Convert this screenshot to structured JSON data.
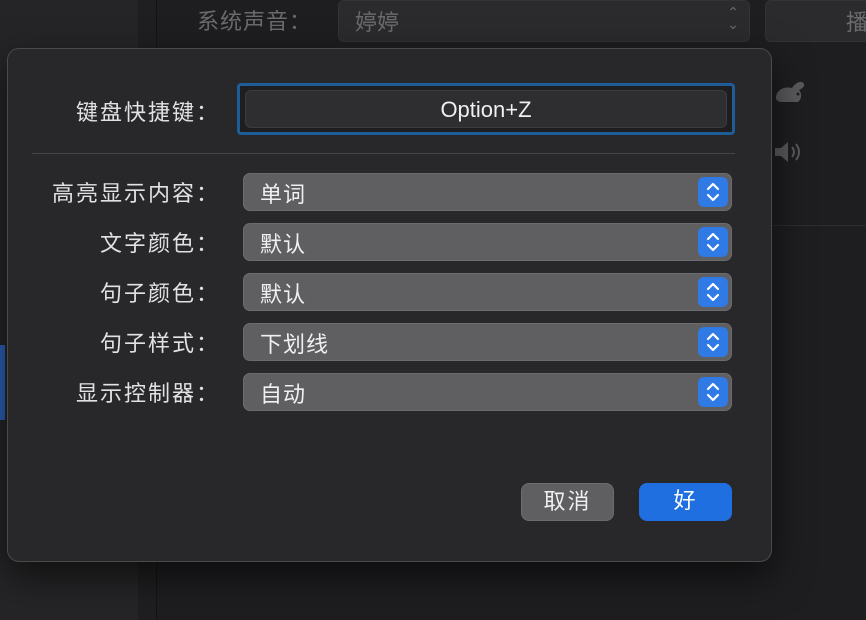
{
  "background": {
    "system_sound_label": "系统声音：",
    "system_sound_value": "婷婷",
    "play_button_label": "播"
  },
  "dialog": {
    "shortcut": {
      "label": "键盘快捷键：",
      "value": "Option+Z"
    },
    "fields": [
      {
        "label": "高亮显示内容：",
        "value": "单词"
      },
      {
        "label": "文字颜色：",
        "value": "默认"
      },
      {
        "label": "句子颜色：",
        "value": "默认"
      },
      {
        "label": "句子样式：",
        "value": "下划线"
      },
      {
        "label": "显示控制器：",
        "value": "自动"
      }
    ],
    "cancel_label": "取消",
    "ok_label": "好"
  },
  "colors": {
    "accent": "#1f6fe0",
    "focus_ring": "#1f5d98",
    "sheet_bg": "#28282a"
  },
  "icons": {
    "stepper": "chevron-up-down-icon",
    "rabbit": "rabbit-icon",
    "speaker": "speaker-icon"
  }
}
